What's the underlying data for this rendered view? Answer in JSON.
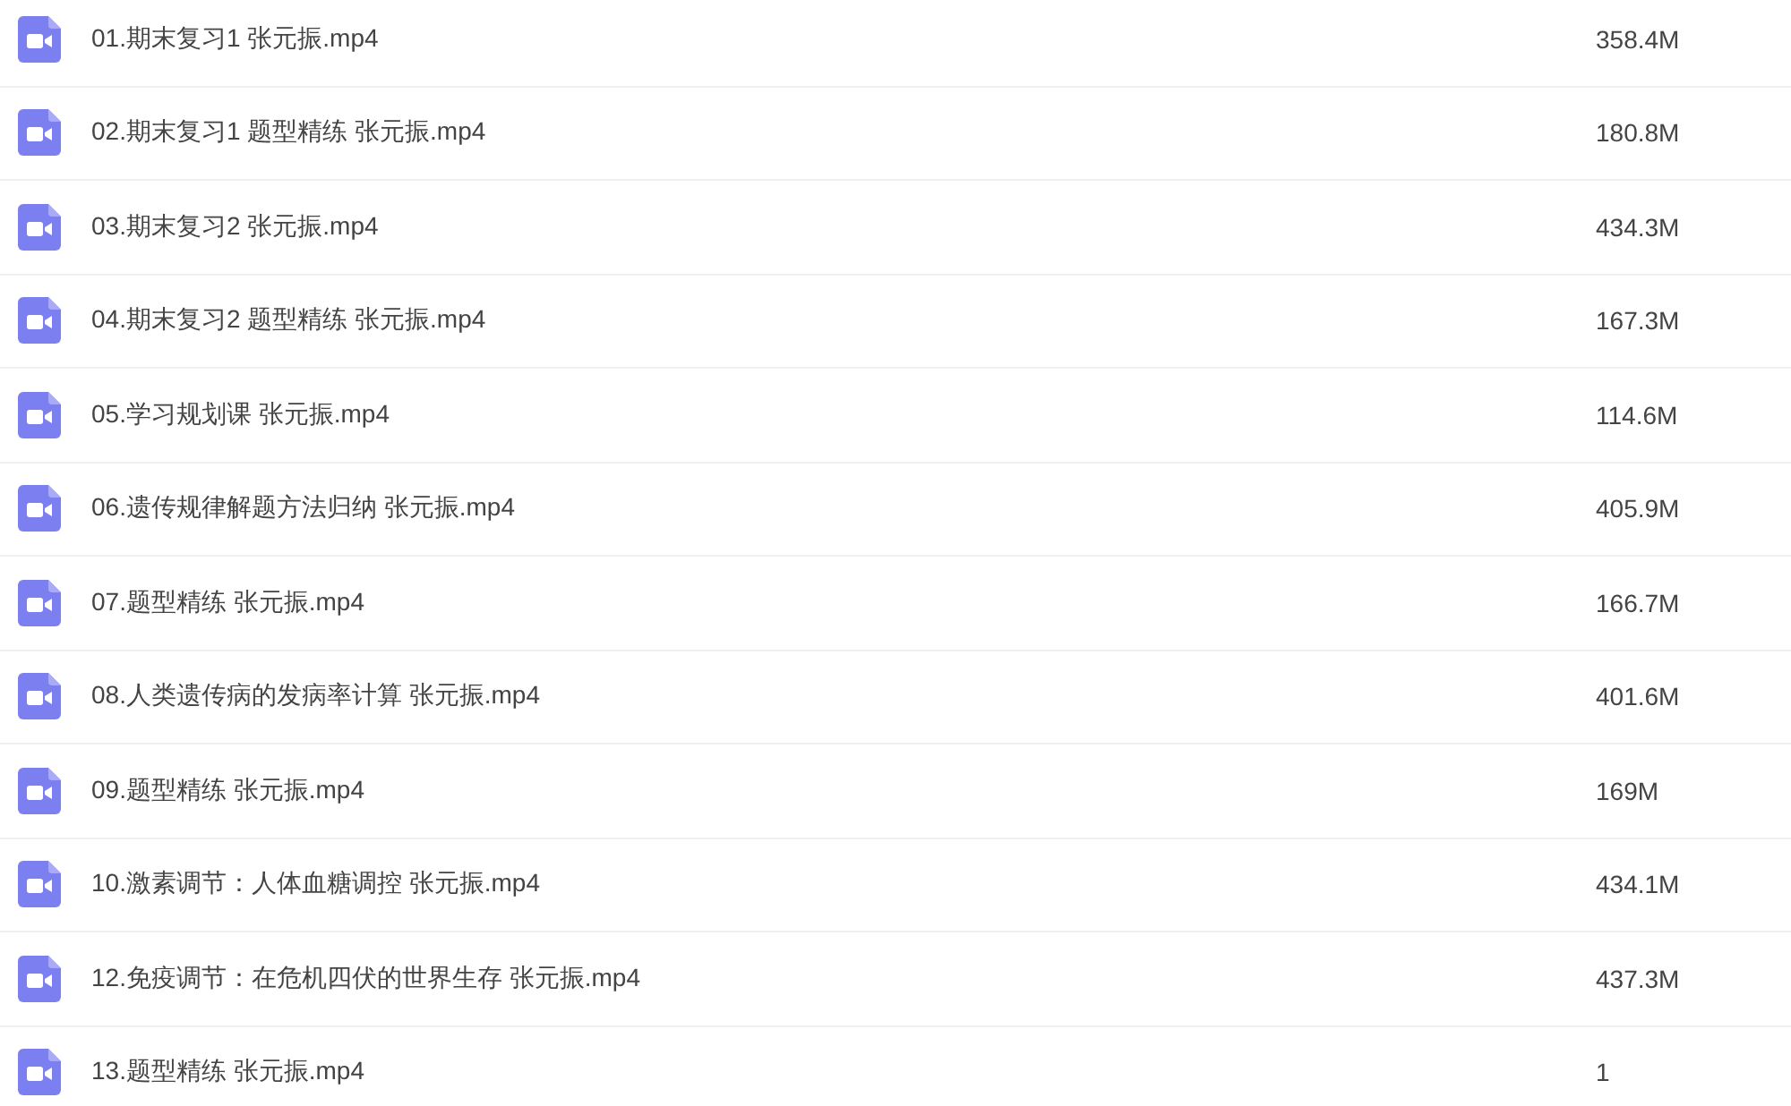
{
  "files": [
    {
      "name": "01.期末复习1 张元振.mp4",
      "size": "358.4M"
    },
    {
      "name": "02.期末复习1 题型精练 张元振.mp4",
      "size": "180.8M"
    },
    {
      "name": "03.期末复习2 张元振.mp4",
      "size": "434.3M"
    },
    {
      "name": "04.期末复习2 题型精练 张元振.mp4",
      "size": "167.3M"
    },
    {
      "name": "05.学习规划课 张元振.mp4",
      "size": "114.6M"
    },
    {
      "name": "06.遗传规律解题方法归纳 张元振.mp4",
      "size": "405.9M"
    },
    {
      "name": "07.题型精练 张元振.mp4",
      "size": "166.7M"
    },
    {
      "name": "08.人类遗传病的发病率计算 张元振.mp4",
      "size": "401.6M"
    },
    {
      "name": "09.题型精练 张元振.mp4",
      "size": "169M"
    },
    {
      "name": "10.激素调节：人体血糖调控 张元振.mp4",
      "size": "434.1M"
    },
    {
      "name": "12.免疫调节：在危机四伏的世界生存 张元振.mp4",
      "size": "437.3M"
    },
    {
      "name": "13.题型精练 张元振.mp4",
      "size": "1"
    }
  ]
}
